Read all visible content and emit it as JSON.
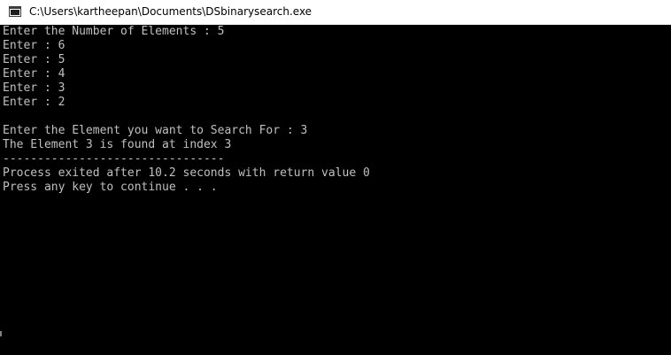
{
  "window": {
    "title": "C:\\Users\\kartheepan\\Documents\\DSbinarysearch.exe",
    "icon": "console-app-icon"
  },
  "colors": {
    "titlebar_bg": "#ffffff",
    "console_bg": "#000000",
    "console_text": "#c0c0c0"
  },
  "console": {
    "lines": [
      "Enter the Number of Elements : 5",
      "Enter : 6",
      "Enter : 5",
      "Enter : 4",
      "Enter : 3",
      "Enter : 2",
      "",
      "Enter the Element you want to Search For : 3",
      "The Element 3 is found at index 3",
      "--------------------------------",
      "Process exited after 10.2 seconds with return value 0",
      "Press any key to continue . . ."
    ]
  }
}
